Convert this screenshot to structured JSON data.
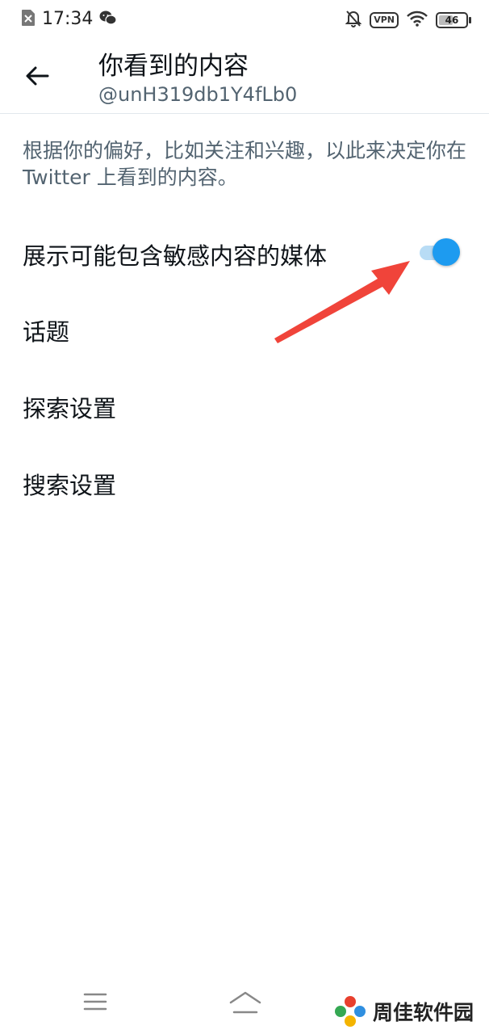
{
  "status_bar": {
    "time": "17:34",
    "vpn_label": "VPN",
    "battery_level": "46",
    "icons": [
      "sim-off-icon",
      "wechat-icon",
      "bell-off-icon",
      "vpn-icon",
      "wifi-icon",
      "battery-icon"
    ]
  },
  "header": {
    "back_icon": "arrow-left-icon",
    "title": "你看到的内容",
    "subtitle": "@unH319db1Y4fLb0"
  },
  "description": "根据你的偏好，比如关注和兴趣，以此来决定你在 Twitter 上看到的内容。",
  "settings": {
    "sensitive_media": {
      "label": "展示可能包含敏感内容的媒体",
      "enabled": true
    },
    "topics": {
      "label": "话题"
    },
    "explore": {
      "label": "探索设置"
    },
    "search": {
      "label": "搜索设置"
    }
  },
  "colors": {
    "accent": "#1d9bf0",
    "toggle_track": "#b8dcf5",
    "secondary_text": "#536471",
    "annotation_arrow": "#f0443a"
  },
  "nav": {
    "icons": [
      "menu-icon",
      "home-icon"
    ]
  },
  "watermark": {
    "text": "周佳软件园"
  }
}
